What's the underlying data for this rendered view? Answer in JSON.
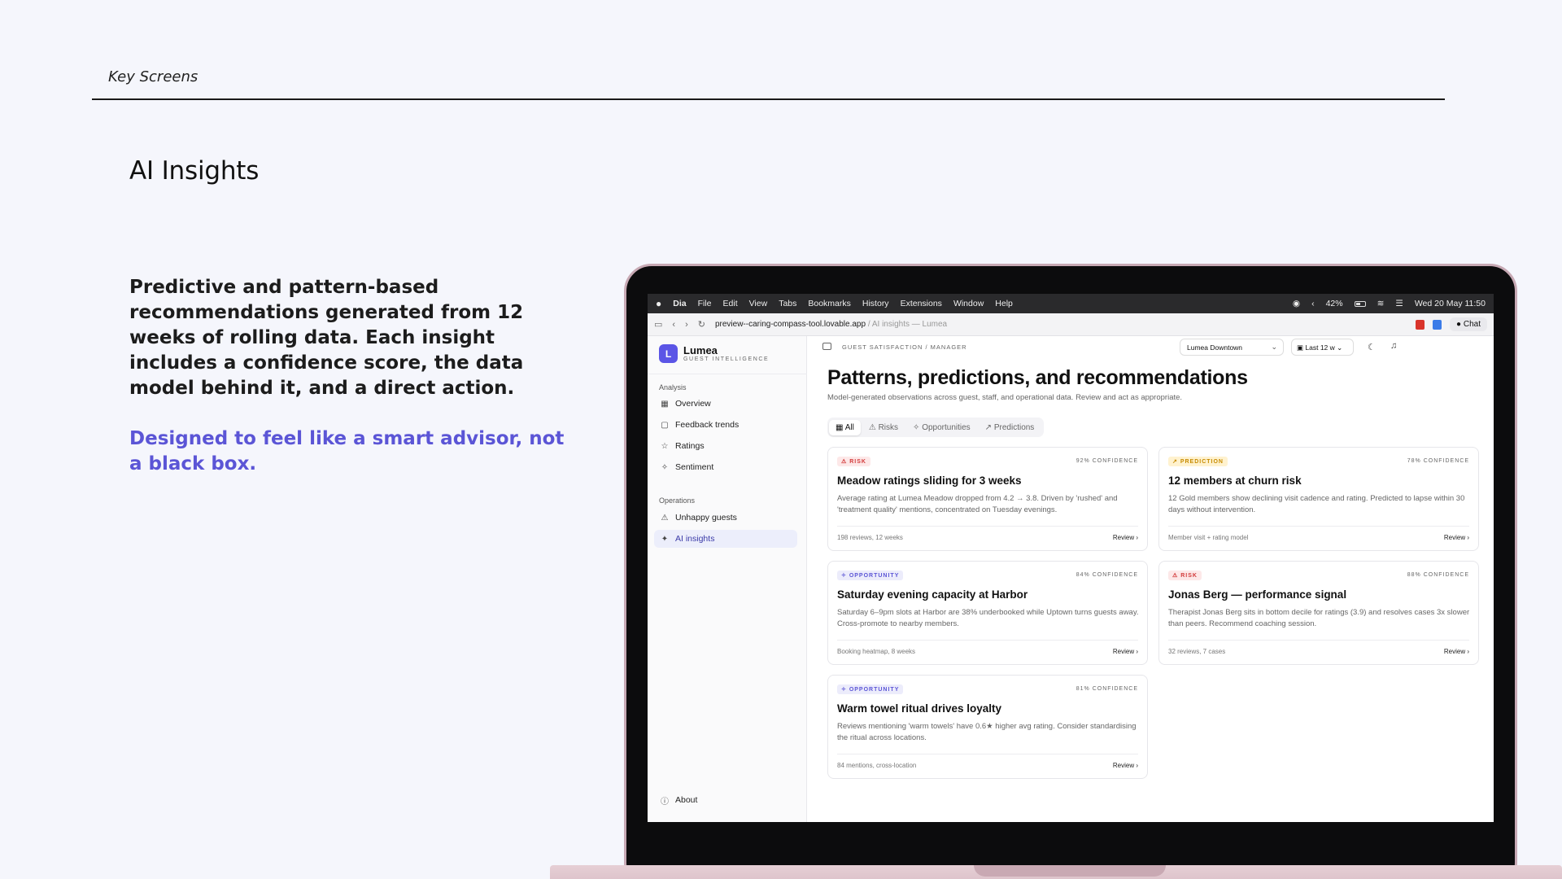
{
  "slide": {
    "header": "Key Screens",
    "title": "AI Insights",
    "body": "Predictive and pattern-based recommendations generated from 12 weeks of rolling data. Each insight includes a confidence score, the data model behind it, and a direct action.",
    "accent": "Designed to feel like a smart advisor, not a black box."
  },
  "menubar": {
    "app": "Dia",
    "items": [
      "File",
      "Edit",
      "View",
      "Tabs",
      "Bookmarks",
      "History",
      "Extensions",
      "Window",
      "Help"
    ],
    "battery": "42%",
    "battery_level": 0.42,
    "datetime": "Wed 20 May  11:50"
  },
  "browser": {
    "url": "preview--caring-compass-tool.lovable.app",
    "url_suffix": " / AI insights — Lumea",
    "chat_label": "Chat"
  },
  "sidebar": {
    "brand_initial": "L",
    "brand_name": "Lumea",
    "brand_sub": "GUEST INTELLIGENCE",
    "analysis_label": "Analysis",
    "analysis_items": [
      "Overview",
      "Feedback trends",
      "Ratings",
      "Sentiment"
    ],
    "operations_label": "Operations",
    "operations_items": [
      "Unhappy guests",
      "AI insights"
    ],
    "about": "About"
  },
  "topbar": {
    "breadcrumb": "GUEST SATISFACTION / MANAGER",
    "location": "Lumea Downtown",
    "range": "Last 12 w"
  },
  "page": {
    "title": "Patterns, predictions, and recommendations",
    "subtitle": "Model-generated observations across guest, staff, and operational data. Review and act as appropriate."
  },
  "filters": [
    "All",
    "Risks",
    "Opportunities",
    "Predictions"
  ],
  "cards": [
    {
      "badge": "RISK",
      "confidence": "92% CONFIDENCE",
      "title": "Meadow ratings sliding for 3 weeks",
      "desc": "Average rating at Lumea Meadow dropped from 4.2 → 3.8. Driven by 'rushed' and 'treatment quality' mentions, concentrated on Tuesday evenings.",
      "meta": "198 reviews, 12 weeks",
      "action": "Review ›"
    },
    {
      "badge": "PREDICTION",
      "confidence": "78% CONFIDENCE",
      "title": "12 members at churn risk",
      "desc": "12 Gold members show declining visit cadence and rating. Predicted to lapse within 30 days without intervention.",
      "meta": "Member visit + rating model",
      "action": "Review ›"
    },
    {
      "badge": "OPPORTUNITY",
      "confidence": "84% CONFIDENCE",
      "title": "Saturday evening capacity at Harbor",
      "desc": "Saturday 6–9pm slots at Harbor are 38% underbooked while Uptown turns guests away. Cross-promote to nearby members.",
      "meta": "Booking heatmap, 8 weeks",
      "action": "Review ›"
    },
    {
      "badge": "RISK",
      "confidence": "88% CONFIDENCE",
      "title": "Jonas Berg — performance signal",
      "desc": "Therapist Jonas Berg sits in bottom decile for ratings (3.9) and resolves cases 3x slower than peers. Recommend coaching session.",
      "meta": "32 reviews, 7 cases",
      "action": "Review ›"
    },
    {
      "badge": "OPPORTUNITY",
      "confidence": "81% CONFIDENCE",
      "title": "Warm towel ritual drives loyalty",
      "desc": "Reviews mentioning 'warm towels' have 0.6★ higher avg rating. Consider standardising the ritual across locations.",
      "meta": "84 mentions, cross-location",
      "action": "Review ›"
    }
  ]
}
